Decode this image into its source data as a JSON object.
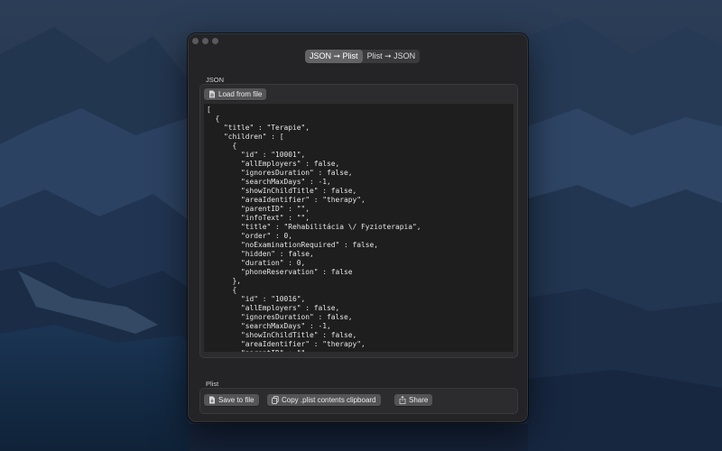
{
  "window": {
    "segments": [
      {
        "label": "JSON ➞ Plist",
        "active": true
      },
      {
        "label": "Plist ➞ JSON",
        "active": false
      }
    ]
  },
  "json_section": {
    "label": "JSON",
    "load_button": "Load from file",
    "code": "[\n  {\n    \"title\" : \"Terapie\",\n    \"children\" : [\n      {\n        \"id\" : \"10001\",\n        \"allEmployers\" : false,\n        \"ignoresDuration\" : false,\n        \"searchMaxDays\" : -1,\n        \"showInChildTitle\" : false,\n        \"areaIdentifier\" : \"therapy\",\n        \"parentID\" : \"\",\n        \"infoText\" : \"\",\n        \"title\" : \"Rehabilitácia \\/ Fyzioterapia\",\n        \"order\" : 0,\n        \"noExaminationRequired\" : false,\n        \"hidden\" : false,\n        \"duration\" : 0,\n        \"phoneReservation\" : false\n      },\n      {\n        \"id\" : \"10016\",\n        \"allEmployers\" : false,\n        \"ignoresDuration\" : false,\n        \"searchMaxDays\" : -1,\n        \"showInChildTitle\" : false,\n        \"areaIdentifier\" : \"therapy\",\n        \"parentID\" : \"\","
  },
  "plist_section": {
    "label": "Plist",
    "save_button": "Save to file",
    "copy_button": "Copy .plist contents clipboard",
    "share_button": "Share"
  },
  "colors": {
    "window_bg": "#242426",
    "button_bg": "#545457",
    "editor_bg": "#1e1e1e"
  }
}
